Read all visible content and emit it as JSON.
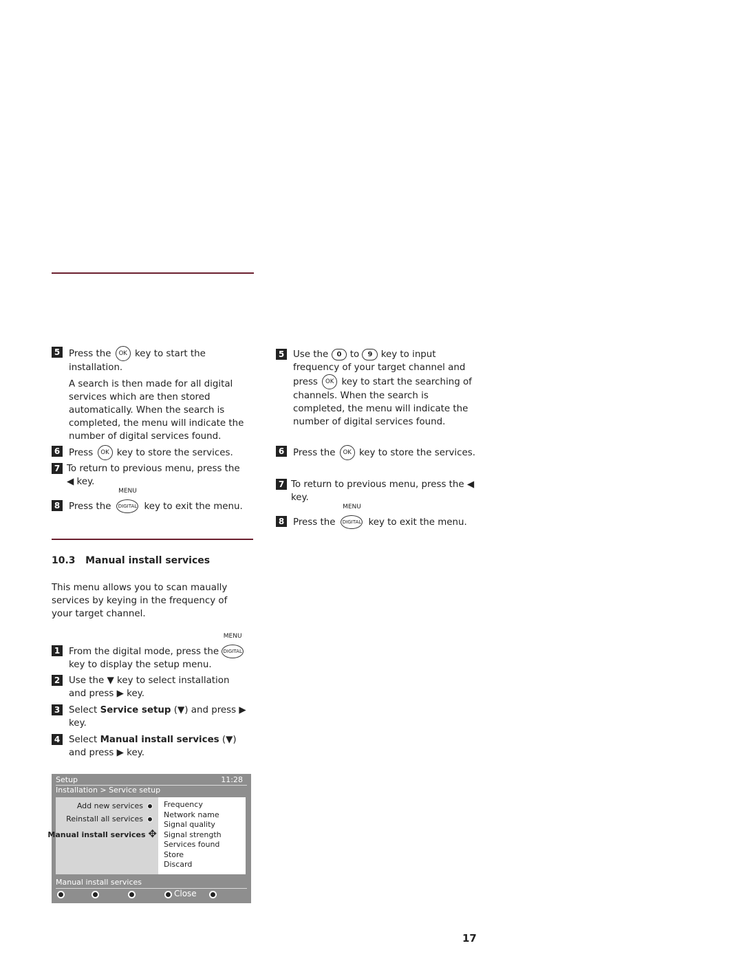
{
  "left": {
    "steps_top": [
      {
        "n": "5",
        "a": "Press the",
        "key": "OK",
        "b": "key to start the installation.",
        "extra": "A search is then made for all digital services which are then stored automatically. When the search is completed, the menu will indicate the number of digital services found."
      },
      {
        "n": "6",
        "a": "Press",
        "key": "OK",
        "b": "key to store the services."
      },
      {
        "n": "7",
        "a": "To return to previous menu, press the ◀ key."
      },
      {
        "n": "8",
        "a": "Press the",
        "menu": "MENU",
        "digital": "DIGITAL",
        "b": "key to exit the menu."
      }
    ],
    "section_number": "10.3",
    "section_title": "Manual install services",
    "intro": "This menu allows you to scan maually services by keying in the frequency of your target channel.",
    "steps": [
      {
        "n": "1",
        "a": "From the digital mode, press the",
        "menu": "MENU",
        "digital": "DIGITAL",
        "b": "key to display the setup menu."
      },
      {
        "n": "2",
        "a": "Use the ▼ key to select installation and press ▶ key."
      },
      {
        "n": "3",
        "a": "Select",
        "bold": "Service setup",
        "b": "(▼) and press ▶ key."
      },
      {
        "n": "4",
        "a": "Select",
        "bold": "Manual install services",
        "b": "(▼) and press ▶ key."
      }
    ]
  },
  "osd": {
    "title": "Setup",
    "time": "11:28",
    "breadcrumb": "Installation > Service setup",
    "left_items": [
      "Add new services",
      "Reinstall all services",
      "Manual install services"
    ],
    "right_items": [
      "Frequency",
      "Network name",
      "Signal quality",
      "Signal strength",
      "Services found",
      "Store",
      "Discard"
    ],
    "status": "Manual install services",
    "close": "Close"
  },
  "right": {
    "steps": [
      {
        "n": "5",
        "a": "Use the",
        "k0": "0",
        "to": "to",
        "k9": "9",
        "b": "key to input frequency of your target channel and press",
        "key": "OK",
        "c": "key to start the searching of channels. When the search is completed, the menu will indicate the number of digital services found."
      },
      {
        "n": "6",
        "a": "Press the",
        "key": "OK",
        "b": "key to store the services."
      },
      {
        "n": "7",
        "a": "To return to previous menu, press the ◀ key."
      },
      {
        "n": "8",
        "a": "Press the",
        "menu": "MENU",
        "digital": "DIGITAL",
        "b": "key to exit the menu."
      }
    ]
  },
  "page_number": "17",
  "colors": {
    "rule": "#6b1f2e",
    "osd_bg": "#8e8e8e"
  }
}
